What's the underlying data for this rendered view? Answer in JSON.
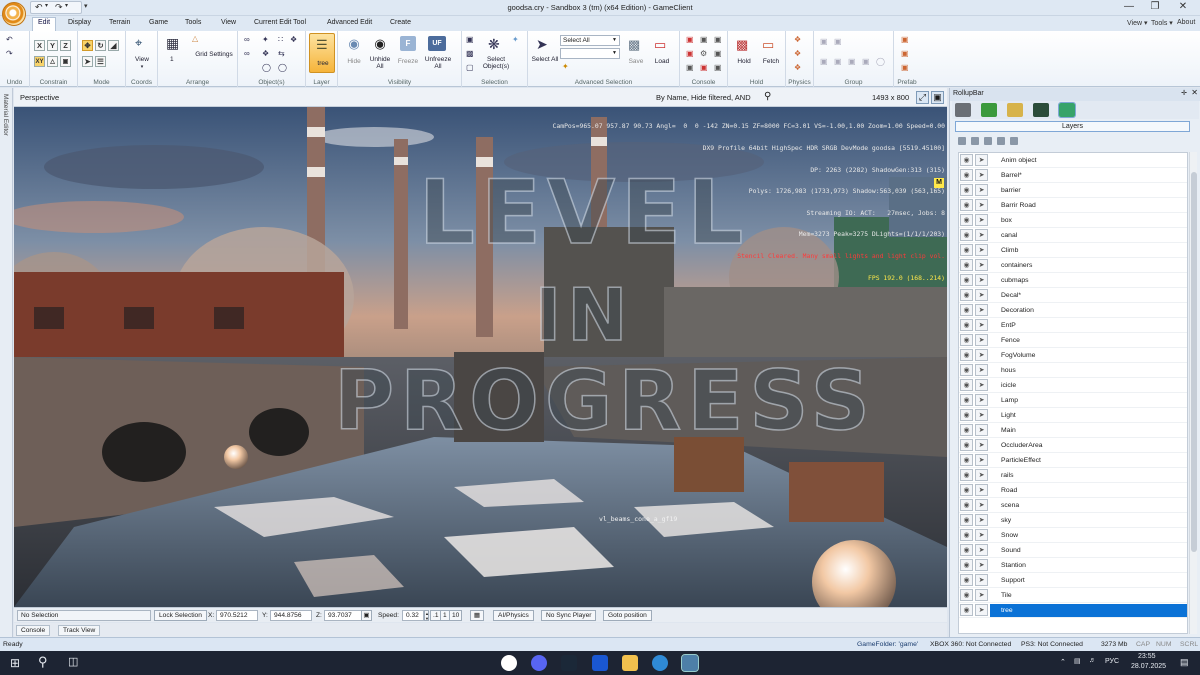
{
  "window": {
    "title": "goodsa.cry - Sandbox 3 (tm) (x64 Edition) - GameClient"
  },
  "menu": {
    "tabs": [
      "Edit",
      "Display",
      "Terrain",
      "Game",
      "Tools",
      "View",
      "Current Edit Tool",
      "Advanced Edit",
      "Create"
    ],
    "right": [
      "View ▾",
      "Tools ▾",
      "About"
    ]
  },
  "ribbon": {
    "groups": [
      "Undo",
      "Constrain",
      "Mode",
      "Coords",
      "Arrange",
      "Object(s)",
      "Layer",
      "Visibility",
      "Selection",
      "Advanced Selection",
      "Console",
      "Hold",
      "Physics",
      "Group",
      "Prefab"
    ],
    "buttons": {
      "view": "View",
      "grid_settings": "Grid Settings",
      "tree": "tree",
      "hide": "Hide",
      "unhide_all": "Unhide All",
      "freeze": "Freeze",
      "unfreeze_all": "Unfreeze All",
      "select_objects": "Select Object(s)",
      "select_all": "Select All",
      "save": "Save",
      "load": "Load",
      "hold": "Hold",
      "fetch": "Fetch"
    },
    "coord_value": "1",
    "select_combo": "Select All"
  },
  "viewport": {
    "label": "Perspective",
    "filter": "By Name, Hide filtered, AND",
    "resolution": "1493 x 800",
    "stats": [
      "CamPos=965.07 957.87 90.73 Angl=  0  0 -142 ZN=0.15 ZF=8000 FC=3.01 VS=-1.00,1.00 Zoom=1.00 Speed=0.00",
      "DX9 Profile 64bit HighSpec HDR SRGB DevMode goodsa [5519.45100]",
      "DP: 2263 (2282) ShadowGen:313 (315)",
      "Polys: 1726,983 (1733,973) Shadow:563,039 (563,165)",
      "Streaming IO: ACT:   27msec, Jobs: 8",
      "Mem=3273 Peak=3275 DLights=(1/1/1/203)"
    ],
    "warning": "Stencil Cleared. Many small lights and light clip vol.",
    "fps": "FPS 192.0 (168..214)",
    "badge": "M",
    "watermark": [
      "LEVEL",
      "IN",
      "PROGRESS"
    ],
    "debug_label": "vl_beams_cone_a_gf19"
  },
  "rollup": {
    "title": "RollupBar",
    "panel_title": "Layers",
    "layers": [
      "Anim object",
      "Barrel*",
      "barrier",
      "Barrir Road",
      "box",
      "canal",
      "Climb",
      "containers",
      "cubmaps",
      "Decal*",
      "Decoration",
      "EntP",
      "Fence",
      "FogVolume",
      "hous",
      "icicle",
      "Lamp",
      "Light",
      "Main",
      "OccluderArea",
      "ParticleEffect",
      "rails",
      "Road",
      "scena",
      "sky",
      "Snow",
      "Sound",
      "Stantion",
      "Support",
      "Tile",
      "tree"
    ],
    "selected_layer": "tree"
  },
  "strip": {
    "selection": "No Selection",
    "lock": "Lock Selection",
    "x_label": "X:",
    "x": "970.5212",
    "y_label": "Y:",
    "y": "944.8756",
    "z_label": "Z:",
    "z": "93.7037",
    "speed_label": "Speed:",
    "speed": "0.32",
    "speed_steps": [
      ".1",
      "1",
      "10"
    ],
    "ai_physics": "AI/Physics",
    "no_sync": "No Sync Player",
    "goto": "Goto position"
  },
  "bottom_tabs": [
    "Console",
    "Track View"
  ],
  "status": {
    "ready": "Ready",
    "game_folder": "GameFolder: 'game'",
    "xbox": "XBOX 360: Not Connected",
    "ps3": "PS3: Not Connected",
    "mem": "3273 Mb",
    "caps": "CAP",
    "num": "NUM",
    "scrl": "SCRL"
  },
  "taskbar": {
    "lang": "РУС",
    "time": "23:55",
    "date": "28.07.2025"
  },
  "colors": {
    "accent": "#0b72d6",
    "ribbon_active": "#f4b232",
    "warning": "#ff3a3a",
    "fps": "#ffe84a"
  }
}
